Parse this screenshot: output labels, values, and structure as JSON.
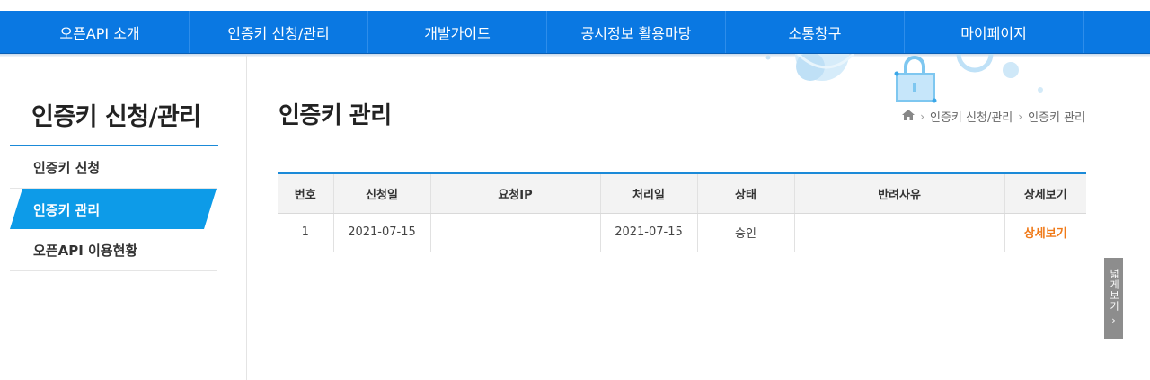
{
  "nav": [
    {
      "label": "오픈API 소개"
    },
    {
      "label": "인증키 신청/관리"
    },
    {
      "label": "개발가이드"
    },
    {
      "label": "공시정보 활용마당"
    },
    {
      "label": "소통창구"
    },
    {
      "label": "마이페이지"
    }
  ],
  "sidebar": {
    "title": "인증키 신청/관리",
    "items": [
      {
        "label": "인증키 신청",
        "active": false
      },
      {
        "label": "인증키 관리",
        "active": true
      },
      {
        "label": "오픈API 이용현황",
        "active": false
      }
    ]
  },
  "page": {
    "title": "인증키 관리",
    "breadcrumb": [
      "인증키 신청/관리",
      "인증키 관리"
    ],
    "home_icon": "home-icon"
  },
  "table": {
    "headers": [
      "번호",
      "신청일",
      "요청IP",
      "처리일",
      "상태",
      "반려사유",
      "상세보기"
    ],
    "rows": [
      {
        "no": "1",
        "apply_date": "2021-07-15",
        "request_ip": "",
        "process_date": "2021-07-15",
        "status": "승인",
        "reject_reason": "",
        "detail": "상세보기"
      }
    ]
  },
  "wide_view": {
    "label": "넓게보기"
  },
  "colors": {
    "nav": "#0a78e2",
    "accent": "#0d9be8",
    "detail_link": "#f07a19"
  }
}
